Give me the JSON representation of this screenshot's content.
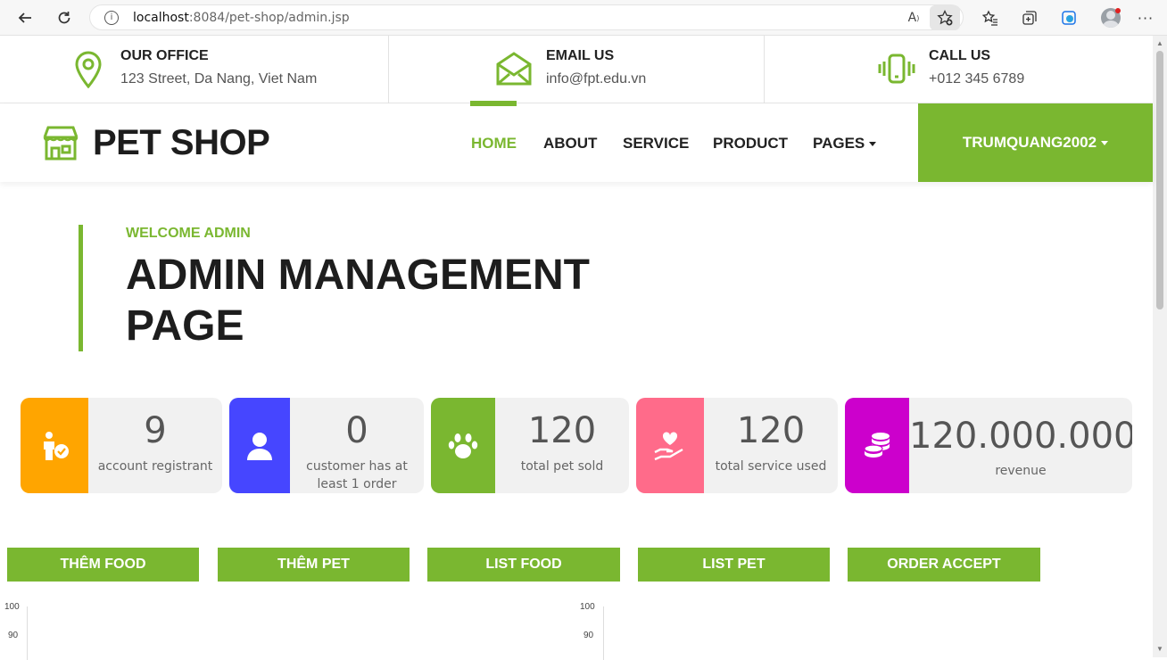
{
  "browser": {
    "url_host": "localhost",
    "url_path": ":8084/pet-shop/admin.jsp"
  },
  "topbar": {
    "office": {
      "title": "OUR OFFICE",
      "text": "123 Street, Da Nang, Viet Nam"
    },
    "email": {
      "title": "EMAIL US",
      "text": "info@fpt.edu.vn"
    },
    "call": {
      "title": "CALL US",
      "text": "+012 345 6789"
    }
  },
  "navbar": {
    "logo": "PET SHOP",
    "items": [
      "HOME",
      "ABOUT",
      "SERVICE",
      "PRODUCT",
      "PAGES"
    ],
    "active": "HOME",
    "user": "TRUMQUANG2002"
  },
  "header": {
    "subtitle": "WELCOME ADMIN",
    "title": "ADMIN MANAGEMENT PAGE"
  },
  "stats": [
    {
      "value": "9",
      "label": "account registrant",
      "color": "#ffa500",
      "icon": "user-check-icon"
    },
    {
      "value": "0",
      "label": "customer has at least 1 order",
      "color": "#4646ff",
      "icon": "user-icon"
    },
    {
      "value": "120",
      "label": "total pet sold",
      "color": "#7ab730",
      "icon": "paw-icon"
    },
    {
      "value": "120",
      "label": "total service used",
      "color": "#ff6b8a",
      "icon": "hand-heart-icon"
    },
    {
      "value": "120.000.000",
      "label": "revenue",
      "color": "#cc00cc",
      "icon": "coins-icon"
    }
  ],
  "actions": [
    "THÊM FOOD",
    "THÊM PET",
    "LIST FOOD",
    "LIST PET",
    "ORDER ACCEPT"
  ],
  "charts": [
    {
      "ticks": [
        "100",
        "90"
      ]
    },
    {
      "ticks": [
        "100",
        "90"
      ]
    }
  ],
  "colors": {
    "accent": "#7ab730"
  }
}
